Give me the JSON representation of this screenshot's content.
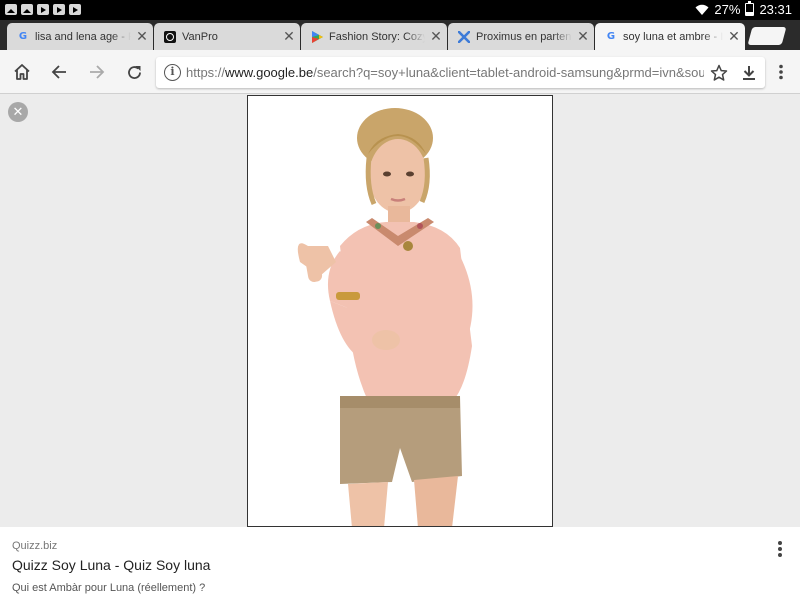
{
  "status_bar": {
    "battery": "27%",
    "time": "23:31"
  },
  "tabs": [
    {
      "title": "lisa and lena age - R",
      "favicon": "google-icon"
    },
    {
      "title": "VanPro",
      "favicon": "vanpro-icon"
    },
    {
      "title": "Fashion Story: Cozy",
      "favicon": "play-store-icon"
    },
    {
      "title": "Proximus en partena",
      "favicon": "proximus-icon"
    },
    {
      "title": "soy luna et ambre - I",
      "favicon": "google-icon",
      "active": true
    }
  ],
  "address_bar": {
    "prefix": "https://",
    "domain": "www.google.be",
    "path": "/search?q=soy+luna&client=tablet-android-samsung&prmd=ivn&source"
  },
  "result": {
    "site": "Quizz.biz",
    "title": "Quizz Soy Luna - Quiz Soy luna",
    "description": "Qui est Ambàr pour Luna (réellement) ?"
  },
  "colors": {
    "tab_strip": "#2b2b2b",
    "active_tab": "#f5f5f5",
    "inactive_tab": "#dadada",
    "viewer_background": "#ececec"
  }
}
